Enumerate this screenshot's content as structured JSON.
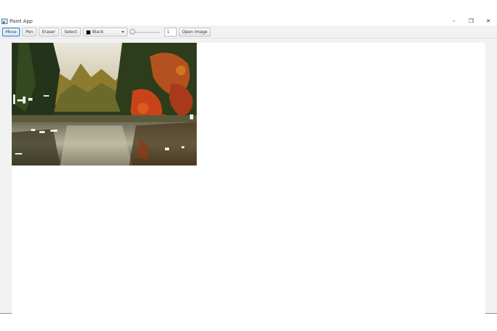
{
  "window": {
    "title": "Paint App",
    "controls": {
      "minimize": "–",
      "restore": "❐",
      "close": "✕"
    }
  },
  "toolbar": {
    "tools": [
      "Move",
      "Pen",
      "Eraser",
      "Select"
    ],
    "active_tool": "Move",
    "color_select": {
      "value": "Black",
      "swatch_color": "#000000"
    },
    "brush_size_slider": {
      "value": 1
    },
    "brush_size_value": "1",
    "open_image_label": "Open Image"
  },
  "canvas": {
    "background": "#ffffff",
    "image": {
      "description_icon": "autumn-lake-photo",
      "accent_colors": [
        "#c9431a",
        "#2f4f1e",
        "#8e7a3a",
        "#d8d0b5"
      ]
    }
  },
  "colors": {
    "active_border": "#3d8fd6",
    "window_bg": "#f2f2f2"
  }
}
